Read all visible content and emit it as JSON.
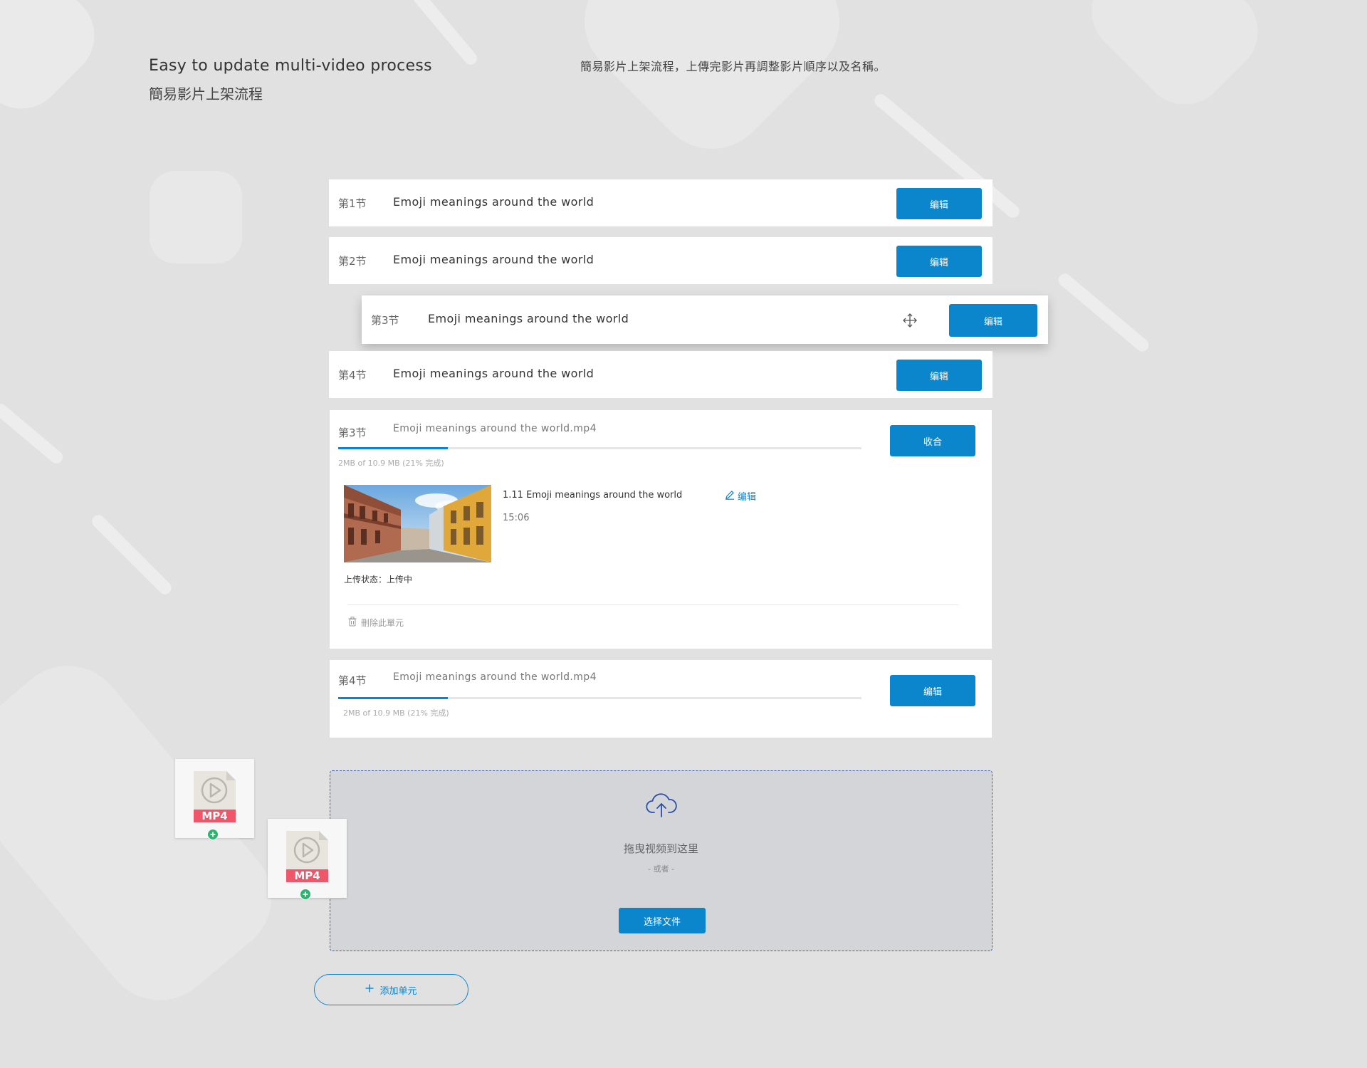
{
  "header": {
    "title_en": "Easy to update multi-video process",
    "title_zh": "簡易影片上架流程",
    "description": "簡易影片上架流程，上傳完影片再調整影片順序以及名稱。"
  },
  "sections": [
    {
      "label": "第1节",
      "title": "Emoji meanings around the world",
      "button": "编辑"
    },
    {
      "label": "第2节",
      "title": "Emoji meanings around the world",
      "button": "编辑"
    },
    {
      "label": "第3节",
      "title": "Emoji meanings around the world",
      "button": "编辑"
    },
    {
      "label": "第4节",
      "title": "Emoji meanings around the world",
      "button": "编辑"
    }
  ],
  "uploads": [
    {
      "label": "第3节",
      "filename": "Emoji meanings around the world.mp4",
      "button": "收合",
      "progress_percent": 21,
      "size_text": "2MB of 10.9 MB (21% 完成)",
      "video": {
        "title": "1.11 Emoji meanings around the world",
        "duration": "15:06",
        "edit_label": "编辑",
        "status": "上传状态：上传中"
      },
      "delete_label": "刪除此單元"
    },
    {
      "label": "第4节",
      "filename": "Emoji meanings around the world.mp4",
      "button": "编辑",
      "progress_percent": 21,
      "size_text": "2MB of 10.9 MB (21% 完成)"
    }
  ],
  "dropzone": {
    "text": "拖曳视频到这里",
    "or_text": "- 或者 -",
    "button": "选择文件"
  },
  "file_icons": [
    {
      "label": "MP4",
      "icon": "mp4-file-icon"
    },
    {
      "label": "MP4",
      "icon": "mp4-file-icon"
    }
  ],
  "add_unit_label": "添加单元",
  "colors": {
    "accent": "#0b85cc",
    "background": "#e1e1e1",
    "mp4_badge": "#f0566a",
    "add_badge": "#2db36f",
    "dropzone_border": "#3a5fb5"
  }
}
